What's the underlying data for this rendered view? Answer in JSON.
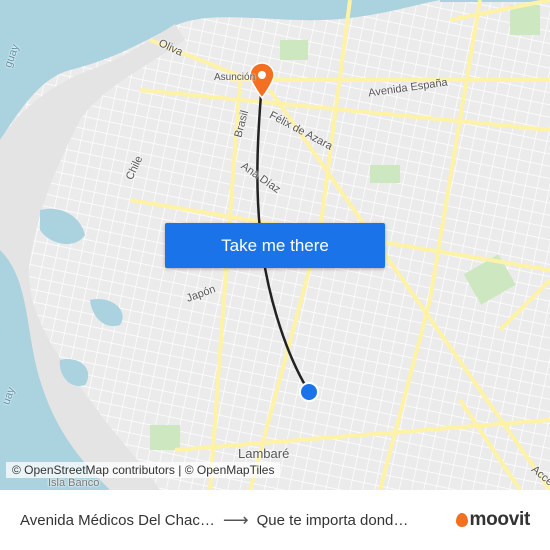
{
  "map": {
    "labels": {
      "oliva": "Oliva",
      "asuncion": "Asunción",
      "avenida_espana": "Avenida España",
      "brasil": "Brasil",
      "felix_de_azara": "Félix de Azara",
      "chile": "Chile",
      "ana_diaz": "Ana Díaz",
      "japon": "Japón",
      "lambare": "Lambaré",
      "acceso": "Acce",
      "paraguay_top": "guay",
      "paraguay_left": "uay",
      "isla_banco": "Isla Banco"
    },
    "colors": {
      "water": "#aad3df",
      "major_road": "#fdf2a5",
      "route": "#222222",
      "origin": "#1a73e8",
      "destination": "#f36f21",
      "park": "#cde8c0"
    }
  },
  "cta": {
    "label": "Take me there"
  },
  "attribution": "© OpenStreetMap contributors | © OpenMapTiles",
  "footer": {
    "origin": "Avenida Médicos Del Chac…",
    "arrow": "⟶",
    "destination": "Que te importa dond…",
    "brand": "moovit"
  }
}
